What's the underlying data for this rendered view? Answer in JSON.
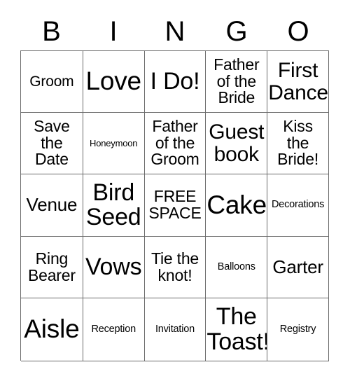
{
  "card": {
    "header_letters": [
      "B",
      "I",
      "N",
      "G",
      "O"
    ],
    "rows": [
      [
        {
          "text": "Groom",
          "size": "m"
        },
        {
          "text": "Love",
          "size": "h"
        },
        {
          "text": "I Do!",
          "size": "xxl"
        },
        {
          "text": "Father\nof the\nBride",
          "size": "ml"
        },
        {
          "text": "First\nDance",
          "size": "xl"
        }
      ],
      [
        {
          "text": "Save\nthe\nDate",
          "size": "ml"
        },
        {
          "text": "Honeymoon",
          "size": "xs"
        },
        {
          "text": "Father\nof the\nGroom",
          "size": "ml"
        },
        {
          "text": "Guest\nbook",
          "size": "xl"
        },
        {
          "text": "Kiss\nthe\nBride!",
          "size": "ml"
        }
      ],
      [
        {
          "text": "Venue",
          "size": "l"
        },
        {
          "text": "Bird\nSeed",
          "size": "xxl"
        },
        {
          "text": "FREE\nSPACE",
          "size": "ml"
        },
        {
          "text": "Cake",
          "size": "h"
        },
        {
          "text": "Decorations",
          "size": "s"
        }
      ],
      [
        {
          "text": "Ring\nBearer",
          "size": "ml"
        },
        {
          "text": "Vows",
          "size": "xxl"
        },
        {
          "text": "Tie the\nknot!",
          "size": "ml"
        },
        {
          "text": "Balloons",
          "size": "s"
        },
        {
          "text": "Garter",
          "size": "l"
        }
      ],
      [
        {
          "text": "Aisle",
          "size": "h"
        },
        {
          "text": "Reception",
          "size": "s"
        },
        {
          "text": "Invitation",
          "size": "s"
        },
        {
          "text": "The\nToast!",
          "size": "xxl"
        },
        {
          "text": "Registry",
          "size": "s"
        }
      ]
    ],
    "free_space_label": "FREE SPACE",
    "colors": {
      "background": "#ffffff",
      "text": "#000000",
      "grid_line": "#6b6b6b"
    }
  }
}
